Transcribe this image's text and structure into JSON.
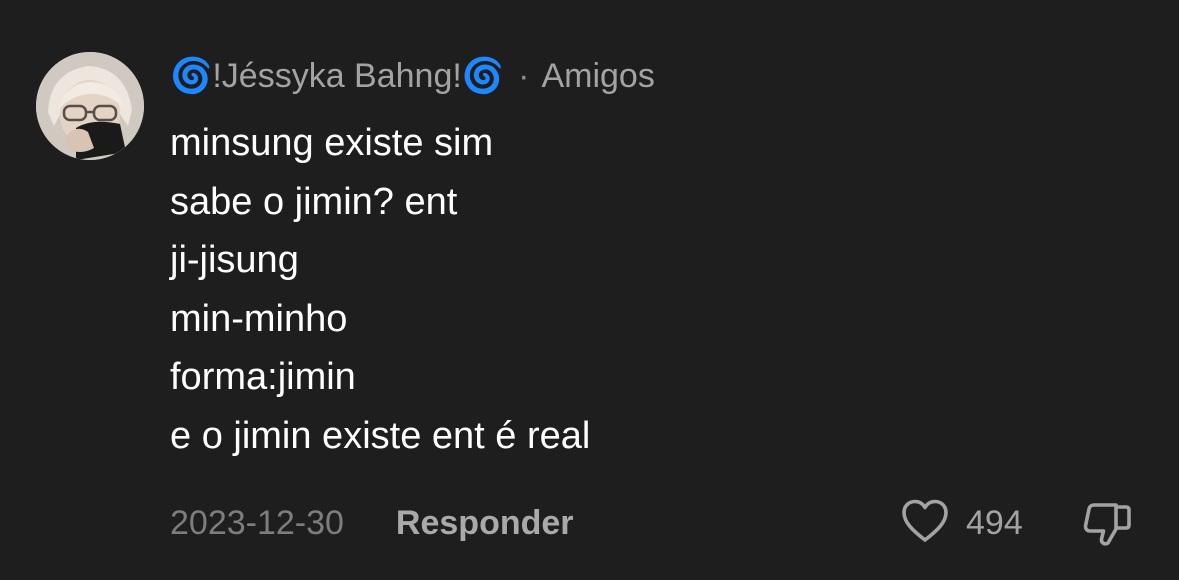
{
  "comment": {
    "author": "🌀!Jéssyka Bahng!🌀",
    "separator": "·",
    "relation": "Amigos",
    "lines": [
      "minsung existe sim",
      "sabe o jimin? ent",
      "ji-jisung",
      "min-minho",
      "forma:jimin",
      "e o jimin existe ent é real"
    ],
    "date": "2023-12-30",
    "reply_label": "Responder",
    "like_count": "494",
    "icons": {
      "like": "heart-outline-icon",
      "dislike": "thumbs-down-icon"
    },
    "colors": {
      "background": "#1e1e1e",
      "text": "#ffffff",
      "muted": "#a3a3a3"
    }
  }
}
